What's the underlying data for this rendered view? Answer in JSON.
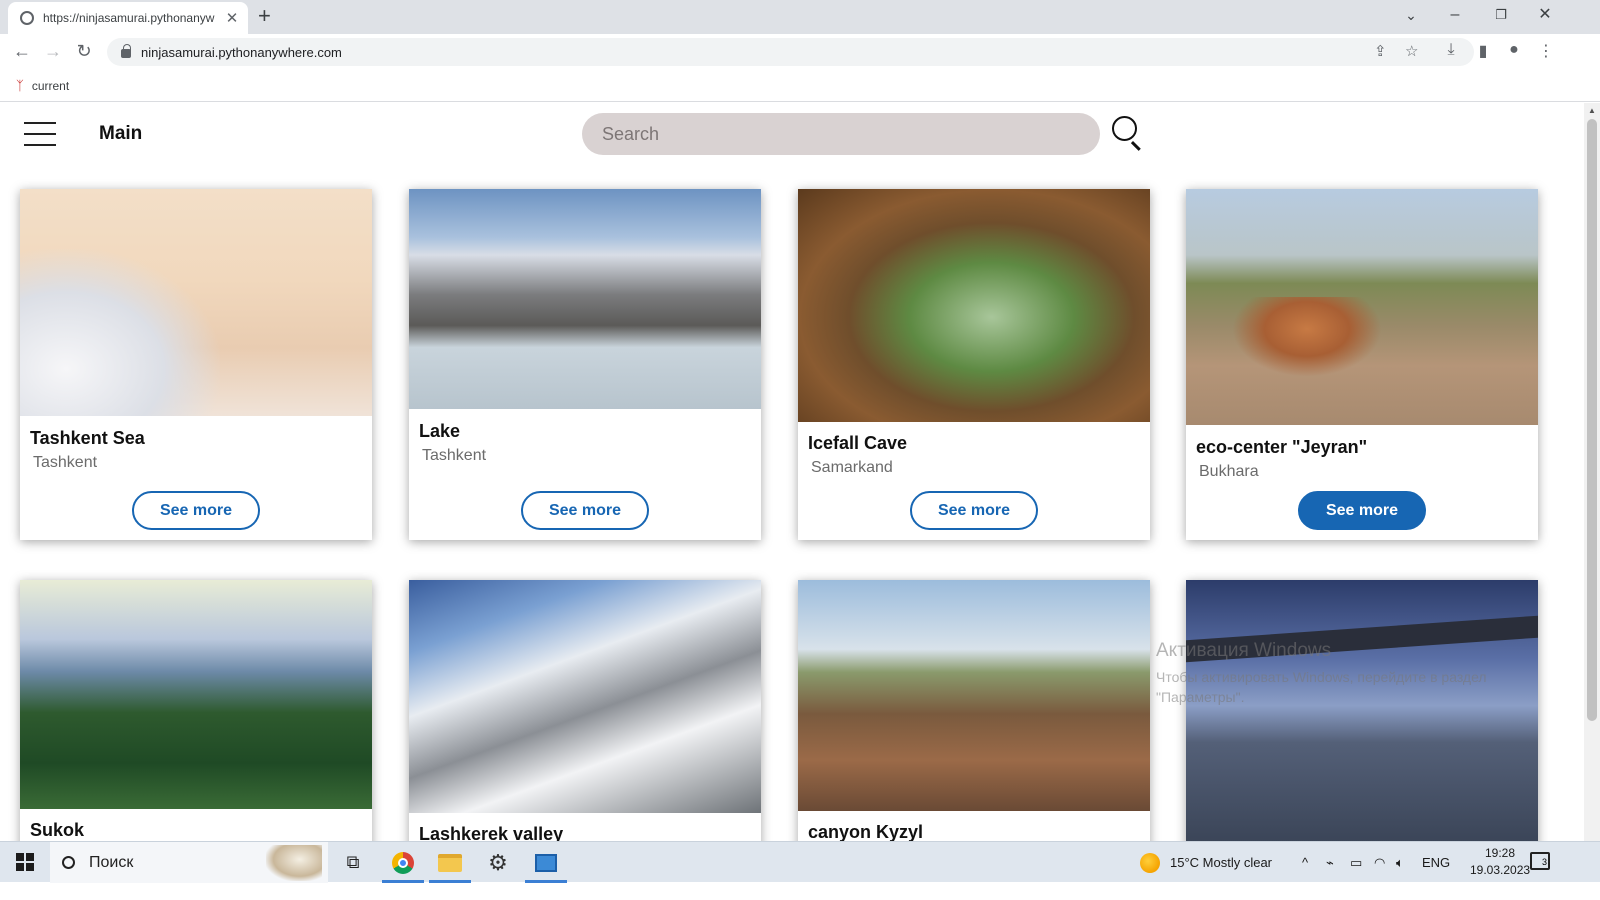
{
  "browser": {
    "tab_title": "https://ninjasamurai.pythonanyw",
    "url": "ninjasamurai.pythonanywhere.com",
    "bookmark_label": "current"
  },
  "site": {
    "brand": "Main",
    "search_placeholder": "Search"
  },
  "cards": [
    {
      "title": "Tashkent Sea",
      "city": "Tashkent",
      "button": "See more"
    },
    {
      "title": "Lake",
      "city": "Tashkent",
      "button": "See more"
    },
    {
      "title": "Icefall Cave",
      "city": "Samarkand",
      "button": "See more"
    },
    {
      "title": "eco-center \"Jeyran\"",
      "city": "Bukhara",
      "button": "See more"
    },
    {
      "title": "Sukok"
    },
    {
      "title": "Lashkerek valley"
    },
    {
      "title": "canyon Kyzyl"
    }
  ],
  "watermark": {
    "line1": "Активация Windows",
    "line2": "Чтобы активировать Windows, перейдите в раздел \"Параметры\"."
  },
  "taskbar": {
    "search_text": "Поиск",
    "weather": "15°C  Mostly clear",
    "lang": "ENG",
    "time": "19:28",
    "date": "19.03.2023",
    "notifications": "3"
  }
}
